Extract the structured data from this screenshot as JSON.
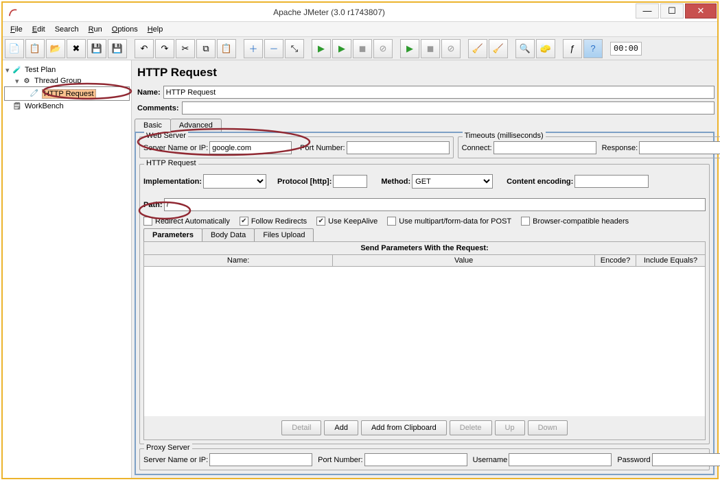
{
  "window": {
    "title": "Apache JMeter (3.0 r1743807)"
  },
  "menu": {
    "file": "File",
    "edit": "Edit",
    "search": "Search",
    "run": "Run",
    "options": "Options",
    "help": "Help"
  },
  "toolbar": {
    "timer": "00:00"
  },
  "tree": {
    "testplan": "Test Plan",
    "threadgroup": "Thread Group",
    "httprequest": "HTTP Request",
    "workbench": "WorkBench"
  },
  "panel": {
    "title": "HTTP Request",
    "name_lbl": "Name:",
    "name_val": "HTTP Request",
    "comments_lbl": "Comments:",
    "tab_basic": "Basic",
    "tab_advanced": "Advanced"
  },
  "webserver": {
    "legend": "Web Server",
    "servername_lbl": "Server Name or IP:",
    "servername_val": "google.com",
    "port_lbl": "Port Number:"
  },
  "timeouts": {
    "legend": "Timeouts (milliseconds)",
    "connect_lbl": "Connect:",
    "response_lbl": "Response:"
  },
  "httpreq": {
    "legend": "HTTP Request",
    "impl_lbl": "Implementation:",
    "proto_lbl": "Protocol [http]:",
    "method_lbl": "Method:",
    "method_val": "GET",
    "enc_lbl": "Content encoding:",
    "path_lbl": "Path:",
    "path_val": "/",
    "redir_auto": "Redirect Automatically",
    "follow": "Follow Redirects",
    "keepalive": "Use KeepAlive",
    "multipart": "Use multipart/form-data for POST",
    "browser": "Browser-compatible headers"
  },
  "subtabs": {
    "params": "Parameters",
    "body": "Body Data",
    "files": "Files Upload"
  },
  "paramtable": {
    "title": "Send Parameters With the Request:",
    "col_name": "Name:",
    "col_value": "Value",
    "col_encode": "Encode?",
    "col_include": "Include Equals?"
  },
  "buttons": {
    "detail": "Detail",
    "add": "Add",
    "addclip": "Add from Clipboard",
    "delete": "Delete",
    "up": "Up",
    "down": "Down"
  },
  "proxy": {
    "legend": "Proxy Server",
    "server_lbl": "Server Name or IP:",
    "port_lbl": "Port Number:",
    "user_lbl": "Username",
    "pass_lbl": "Password"
  }
}
